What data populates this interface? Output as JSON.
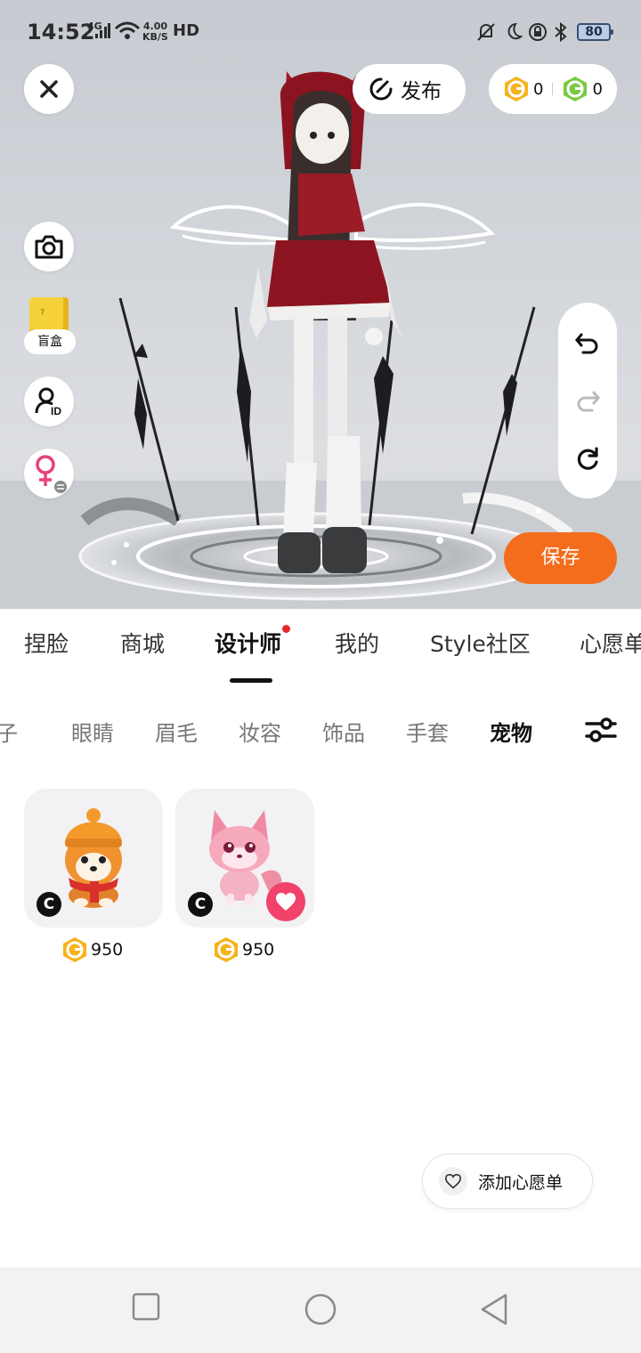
{
  "status_bar": {
    "time": "14:52",
    "network": "4G",
    "speed_value": "4.00",
    "speed_unit": "KB/S",
    "hd": "HD",
    "battery": "80"
  },
  "header": {
    "publish_label": "发布",
    "gold_coins": "0",
    "green_coins": "0"
  },
  "side_tools": {
    "blind_box_label": "盲盒",
    "blind_box_mark": "?"
  },
  "save_label": "保存",
  "tabs": [
    {
      "label": "捏脸"
    },
    {
      "label": "商城"
    },
    {
      "label": "设计师"
    },
    {
      "label": "我的"
    },
    {
      "label": "Style社区"
    },
    {
      "label": "心愿单"
    }
  ],
  "sub_tabs": [
    {
      "label": "鞋子"
    },
    {
      "label": "眼睛"
    },
    {
      "label": "眉毛"
    },
    {
      "label": "妆容"
    },
    {
      "label": "饰品"
    },
    {
      "label": "手套"
    },
    {
      "label": "宠物"
    }
  ],
  "items": [
    {
      "badge": "C",
      "price": "950"
    },
    {
      "badge": "C",
      "price": "950"
    }
  ],
  "wishlist_label": "添加心愿单",
  "colors": {
    "accent_orange": "#f36d1c",
    "tab_dot": "#e42929",
    "heart_pink": "#f0426a",
    "coin_gold": "#f5b31c",
    "coin_green": "#7ac943"
  },
  "icons": [
    "close-icon",
    "publish-icon",
    "gold-coin-icon",
    "green-coin-icon",
    "camera-icon",
    "blind-box-icon",
    "avatar-id-icon",
    "gender-switch-icon",
    "undo-icon",
    "redo-icon",
    "reset-icon",
    "filter-icon",
    "heart-icon",
    "nav-recents-icon",
    "nav-home-icon",
    "nav-back-icon"
  ]
}
